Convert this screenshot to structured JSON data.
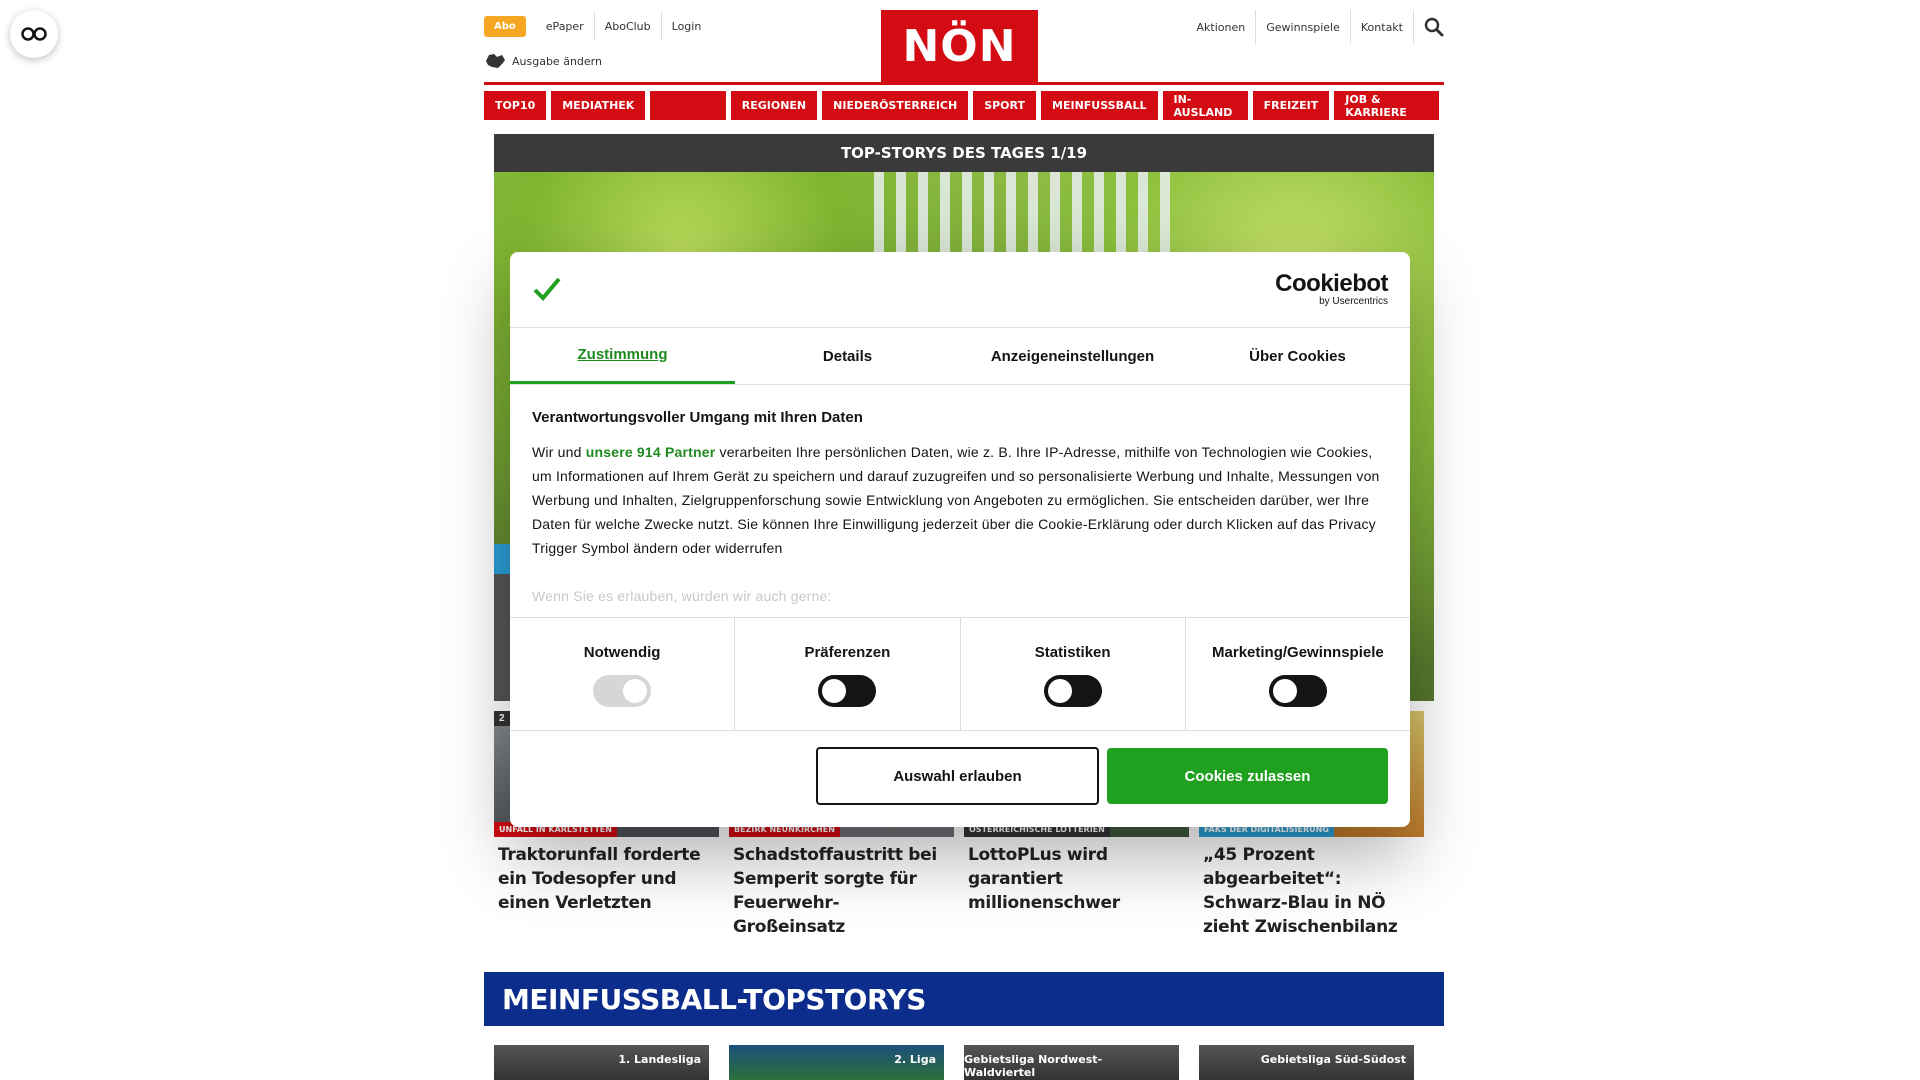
{
  "header": {
    "abo": "Abo",
    "links_left": [
      "ePaper",
      "AboClub",
      "Login"
    ],
    "ausgabe": "Ausgabe ändern",
    "logo": "NÖN",
    "links_right": [
      "Aktionen",
      "Gewinnspiele",
      "Kontakt"
    ]
  },
  "nav": {
    "items": [
      "TOP10",
      "MEDIATHEK",
      "",
      "REGIONEN",
      "NIEDERÖSTERREICH",
      "SPORT",
      "MEINFUSSBALL",
      "IN-AUSLAND",
      "FREIZEIT",
      "JOB & KARRIERE"
    ]
  },
  "topstories": {
    "header": "TOP-STORYS DES TAGES 1/19",
    "stories": [
      {
        "num": "2",
        "category": "UNFALL IN KARLSTETTEN",
        "title": "Traktorunfall forderte ein Todesopfer und einen Verletzten"
      },
      {
        "num": "",
        "category": "BEZIRK NEUNKIRCHEN",
        "title": "Schadstoffaustritt bei Semperit sorgte für Feuerwehr-Großeinsatz"
      },
      {
        "num": "",
        "category": "ÖSTERREICHISCHE LOTTERIEN",
        "title": "LottoPLus wird garantiert millionenschwer"
      },
      {
        "num": "",
        "category": "FAKS DER DIGITALISIERUNG",
        "title": "„45 Prozent abgearbeitet“: Schwarz-Blau in NÖ zieht Zwischenbilanz"
      }
    ]
  },
  "meinfussball": {
    "title": "MEINFUSSBALL-TOPSTORYS",
    "cards": [
      "1. Landesliga",
      "2. Liga",
      "Gebietsliga Nordwest-Waldviertel",
      "Gebietsliga Süd-Südost"
    ]
  },
  "consent": {
    "brand": "Cookiebot",
    "brand_sub": "by Usercentrics",
    "tabs": [
      "Zustimmung",
      "Details",
      "Anzeigeneinstellungen",
      "Über Cookies"
    ],
    "heading": "Verantwortungsvoller Umgang mit Ihren Daten",
    "text_before": "Wir und ",
    "partner_link": "unsere 914 Partner",
    "text_after": " verarbeiten Ihre persönlichen Daten, wie z. B. Ihre IP-Adresse, mithilfe von Technologien wie Cookies, um Informationen auf Ihrem Gerät zu speichern und darauf zuzugreifen und so personalisierte Werbung und Inhalte, Messungen von Werbung und Inhalten, Zielgruppenforschung sowie Entwicklung von Angeboten zu ermöglichen. Sie entscheiden darüber, wer Ihre Daten für welche Zwecke nutzt. Sie können Ihre Einwilligung jederzeit über die Cookie-Erklärung oder durch Klicken auf das Privacy Trigger Symbol ändern oder widerrufen",
    "faded": "Wenn Sie es erlauben, würden wir auch gerne:",
    "toggles": [
      "Notwendig",
      "Präferenzen",
      "Statistiken",
      "Marketing/Gewinnspiele"
    ],
    "btn_allow_selection": "Auswahl erlauben",
    "btn_allow_all": "Cookies zulassen"
  }
}
